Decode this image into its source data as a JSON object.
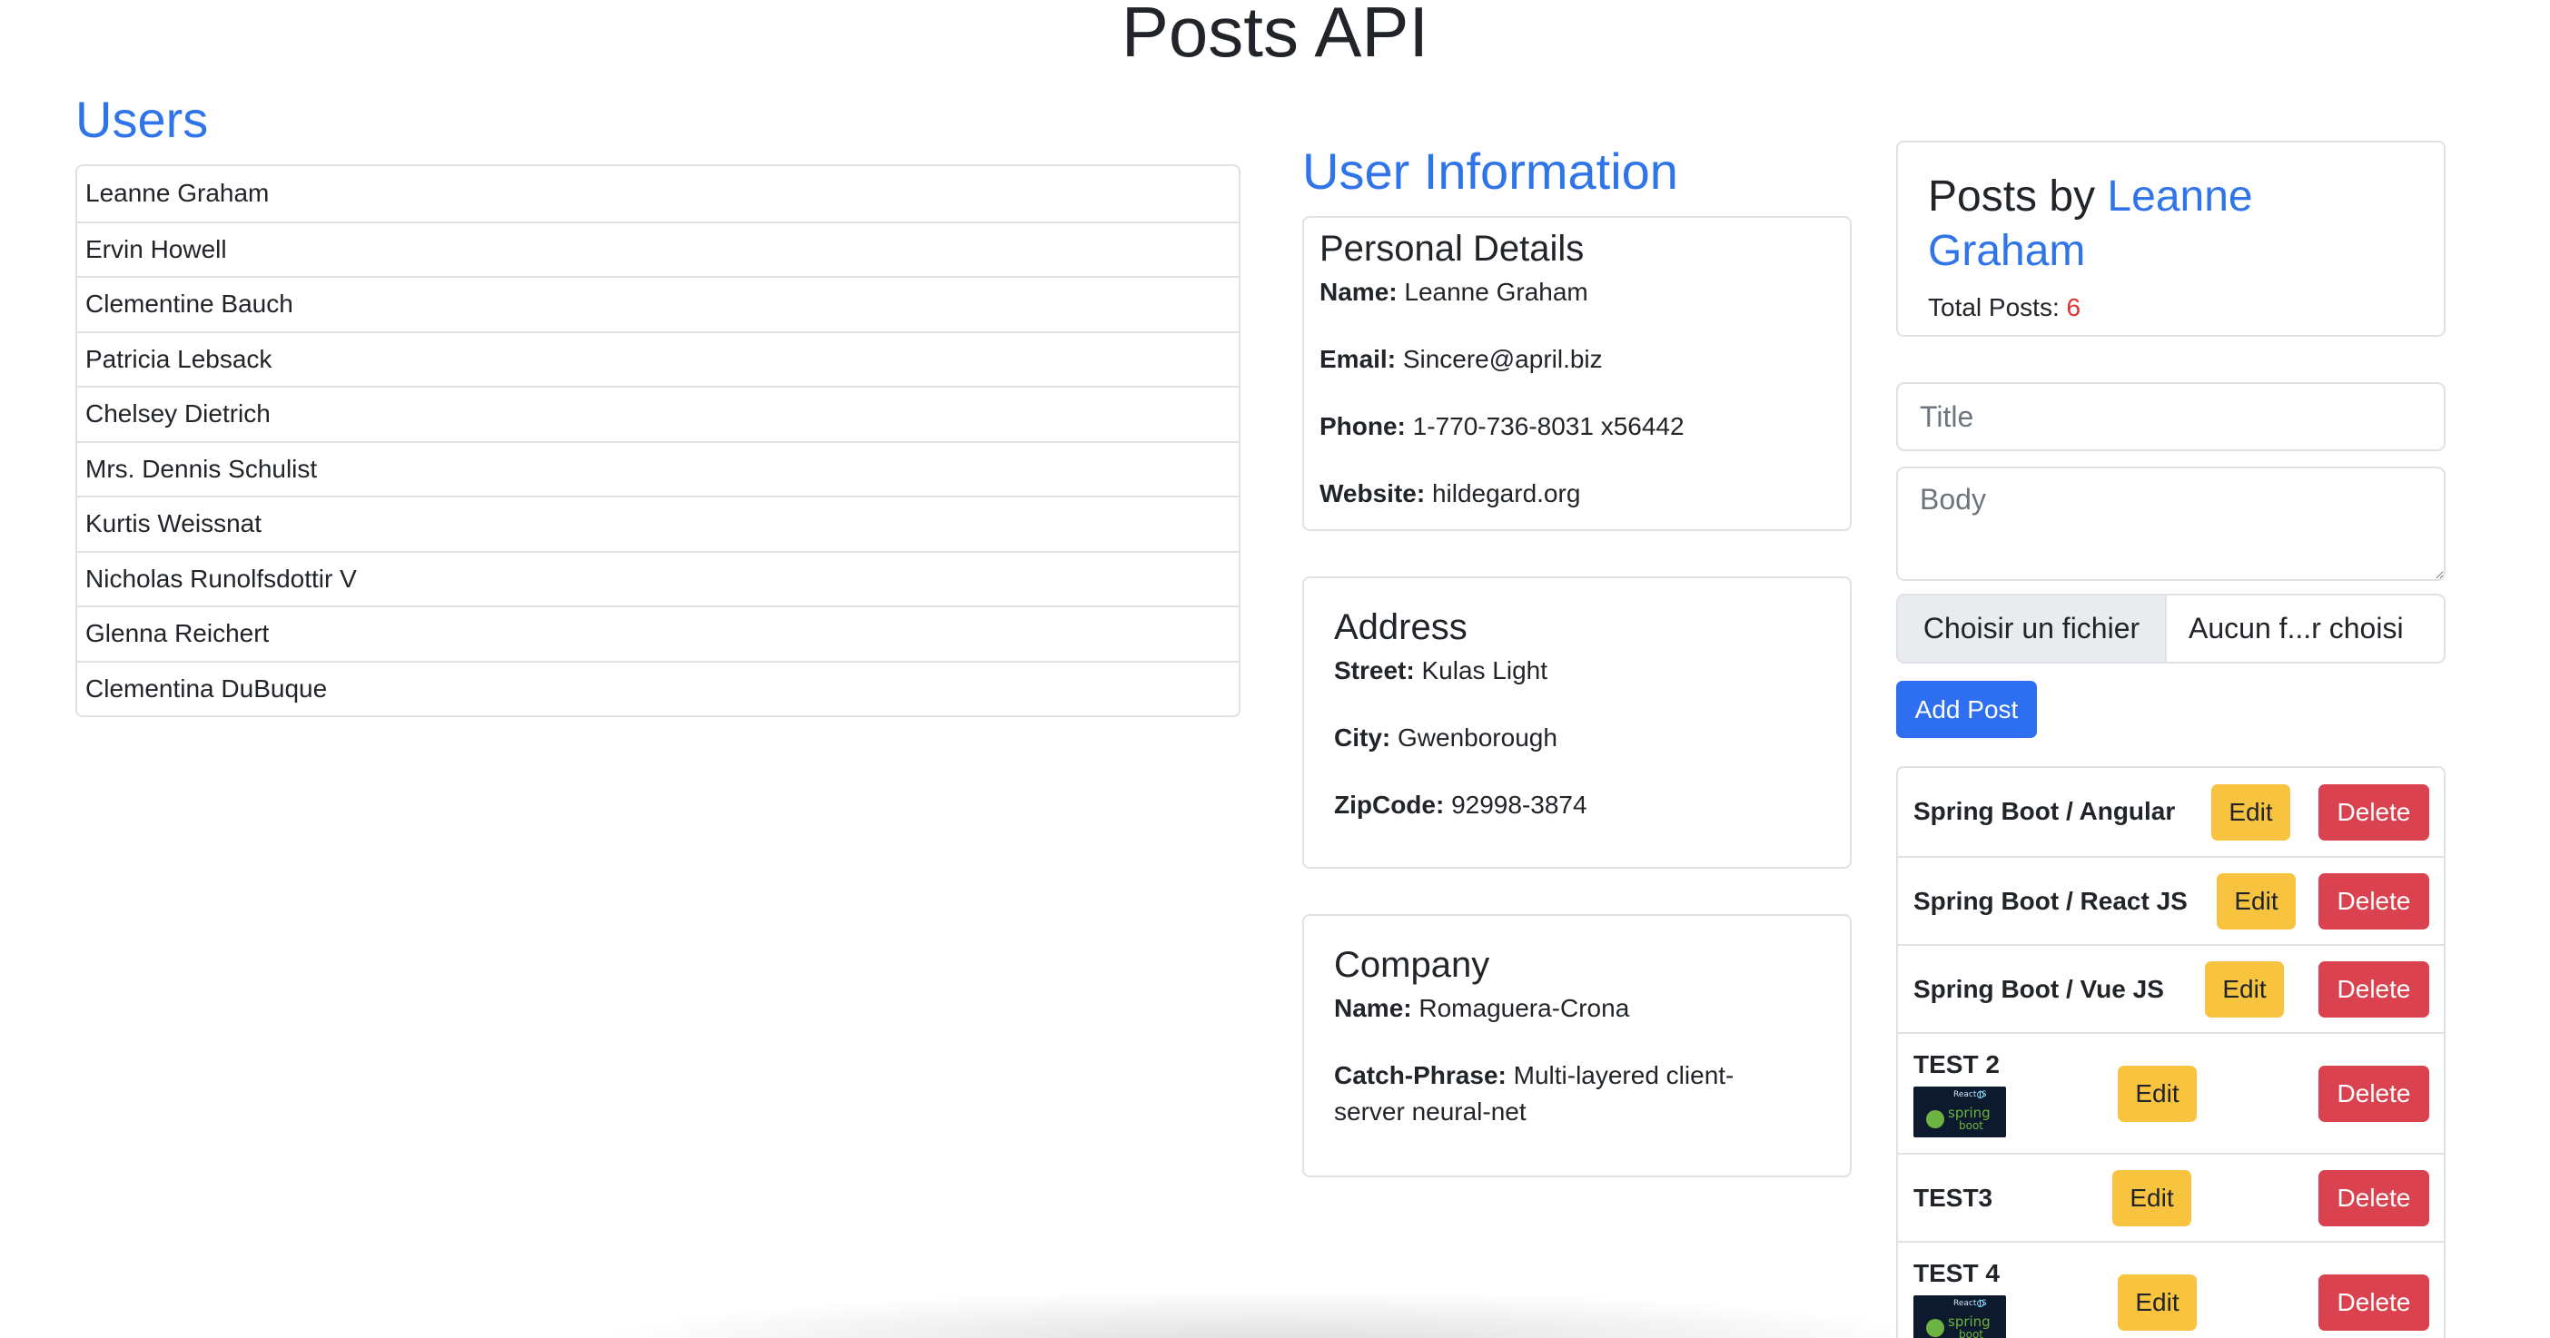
{
  "page": {
    "title": "Posts API"
  },
  "users": {
    "heading": "Users",
    "items": [
      "Leanne Graham",
      "Ervin Howell",
      "Clementine Bauch",
      "Patricia Lebsack",
      "Chelsey Dietrich",
      "Mrs. Dennis Schulist",
      "Kurtis Weissnat",
      "Nicholas Runolfsdottir V",
      "Glenna Reichert",
      "Clementina DuBuque"
    ]
  },
  "user_info": {
    "heading": "User Information",
    "personal": {
      "heading": "Personal Details",
      "name_label": "Name:",
      "name": "Leanne Graham",
      "email_label": "Email:",
      "email": "Sincere@april.biz",
      "phone_label": "Phone:",
      "phone": "1-770-736-8031 x56442",
      "website_label": "Website:",
      "website": "hildegard.org"
    },
    "address": {
      "heading": "Address",
      "street_label": "Street:",
      "street": "Kulas Light",
      "city_label": "City:",
      "city": "Gwenborough",
      "zip_label": "ZipCode:",
      "zip": "92998-3874"
    },
    "company": {
      "heading": "Company",
      "name_label": "Name:",
      "name": "Romaguera-Crona",
      "catch_label": "Catch-Phrase:",
      "catch_line1": "Multi-layered client-",
      "catch_line2": "server neural-net"
    }
  },
  "posts": {
    "heading_prefix": "Posts by",
    "heading_user": "Leanne Graham",
    "total_label": "Total Posts:",
    "total": "6",
    "total_color": "#e03131",
    "link_color": "#2f74e8",
    "form": {
      "title_placeholder": "Title",
      "body_placeholder": "Body",
      "file_button": "Choisir un fichier",
      "file_status": "Aucun f...r choisi",
      "add_button": "Add Post"
    },
    "edit_label": "Edit",
    "delete_label": "Delete",
    "items": [
      {
        "title": "Spring Boot / Angular"
      },
      {
        "title": "Spring Boot / React JS"
      },
      {
        "title": "Spring Boot / Vue JS"
      },
      {
        "title": "TEST 2",
        "thumb_line1": "React JS",
        "thumb_line2": "spring",
        "thumb_line3": "boot"
      },
      {
        "title": "TEST3"
      },
      {
        "title": "TEST 4",
        "thumb_line1": "React JS",
        "thumb_line2": "spring",
        "thumb_line3": "boot"
      }
    ]
  }
}
